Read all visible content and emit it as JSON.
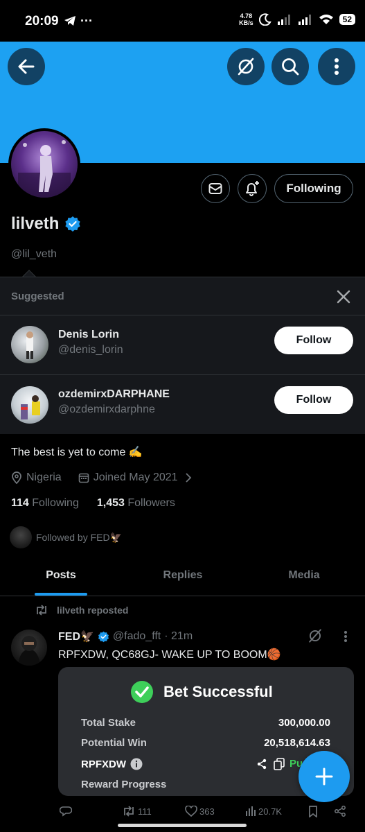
{
  "status_bar": {
    "time": "20:09",
    "net_speed_value": "4.78",
    "net_speed_unit": "KB/s",
    "battery": "52"
  },
  "profile": {
    "display_name": "lilveth",
    "handle": "@lil_veth",
    "following_label": "Following",
    "bio": "The best is yet to come ✍️",
    "location": "Nigeria",
    "joined": "Joined May 2021",
    "following_count": "114",
    "following_label_text": "Following",
    "followers_count": "1,453",
    "followers_label_text": "Followers",
    "followed_by": "Followed by FED🦅"
  },
  "suggested": {
    "label": "Suggested",
    "items": [
      {
        "name": "Denis Lorin",
        "handle": "@denis_lorin",
        "button": "Follow"
      },
      {
        "name": "ozdemirxDARPHANE",
        "handle": "@ozdemirxdarphne",
        "button": "Follow"
      }
    ]
  },
  "tabs": [
    {
      "label": "Posts",
      "active": true
    },
    {
      "label": "Replies",
      "active": false
    },
    {
      "label": "Media",
      "active": false
    }
  ],
  "post": {
    "repost_label": "lilveth reposted",
    "author_name": "FED🦅",
    "author_handle": "@fado_fft",
    "time": "· 21m",
    "text": "RPFXDW, QC68GJ- WAKE UP TO BOOM🏀",
    "card": {
      "title": "Bet Successful",
      "total_stake_label": "Total Stake",
      "total_stake_value": "300,000.00",
      "potential_win_label": "Potential Win",
      "potential_win_value": "20,518,614.63",
      "code": "RPFXDW",
      "code_action_partial": "Pu",
      "reward_label": "Reward Progress"
    },
    "stats": {
      "reposts": "111",
      "likes": "363",
      "views": "20.7K"
    }
  },
  "colors": {
    "banner": "#1da1f2",
    "accent": "#1d9bf0",
    "verified": "#1d9bf0",
    "success": "#3ecf5a"
  }
}
